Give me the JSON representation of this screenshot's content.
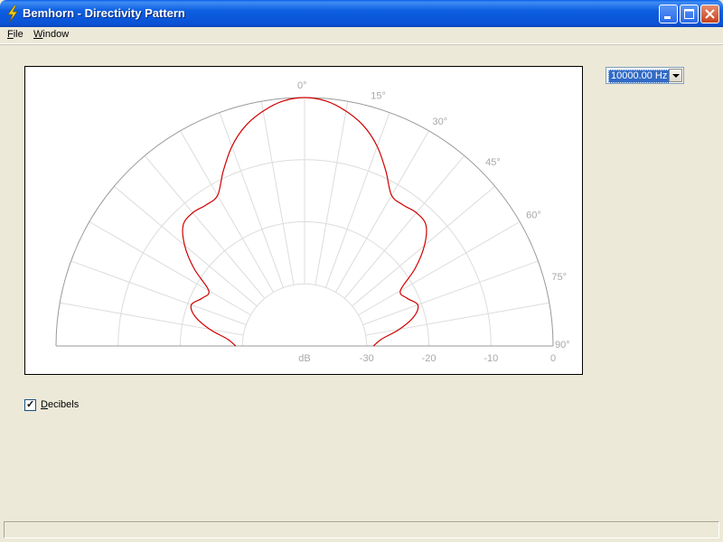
{
  "window": {
    "title": "Bemhorn - Directivity Pattern",
    "icon": "lightning-bolt-icon"
  },
  "menu": {
    "items": [
      "File",
      "Window"
    ]
  },
  "frequency_select": {
    "value": "10000.00 Hz"
  },
  "decibels_checkbox": {
    "label": "Decibels",
    "checked": true
  },
  "colors": {
    "titlebar": "#0a52d6",
    "pattern_line": "#d00000",
    "grid": "#dcdcdc",
    "labels": "#a8a8a8"
  },
  "chart_data": {
    "type": "line",
    "coordinate_system": "polar-half",
    "angle_labels": [
      "0°",
      "15°",
      "30°",
      "45°",
      "60°",
      "75°",
      "90°"
    ],
    "radial_labels": [
      "dB",
      "-30",
      "-20",
      "-10",
      "0"
    ],
    "radial_range_db": [
      -40,
      0
    ],
    "grid": true,
    "series": [
      {
        "angles_deg": [
          0,
          5,
          10,
          15,
          20,
          25,
          30,
          35,
          40,
          45,
          50,
          55,
          60,
          65,
          70,
          75,
          80,
          85,
          90
        ],
        "values_db": [
          0,
          -0.4,
          -1.6,
          -3.3,
          -5.8,
          -9,
          -12,
          -12.3,
          -12,
          -12.4,
          -14.8,
          -18.3,
          -22.2,
          -21.8,
          -20.6,
          -21.8,
          -24.5,
          -27.6,
          -28.9
        ]
      }
    ]
  }
}
